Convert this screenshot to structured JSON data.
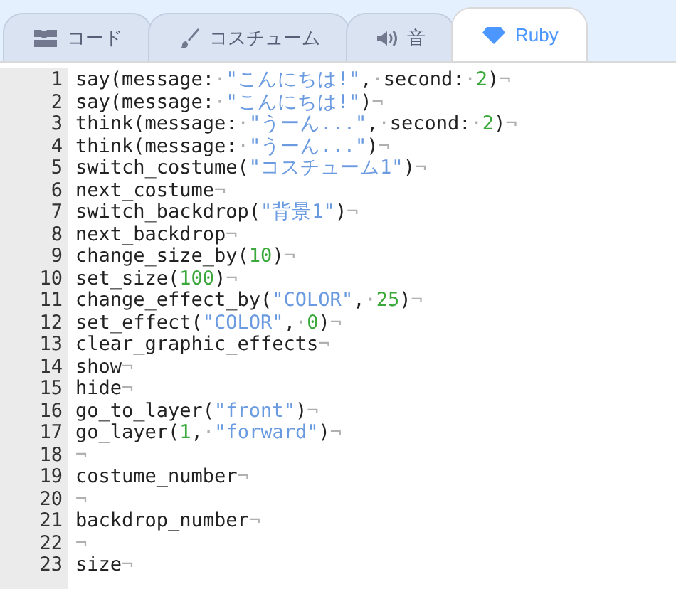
{
  "tabs": [
    {
      "label": "コード",
      "kind": "blocks",
      "selected": false
    },
    {
      "label": "コスチューム",
      "kind": "brush",
      "selected": false
    },
    {
      "label": "音",
      "kind": "speaker",
      "selected": false
    },
    {
      "label": "Ruby",
      "kind": "gem",
      "selected": true
    }
  ],
  "editor": {
    "lines": [
      {
        "number": "1",
        "tokens": [
          {
            "kind": "plain",
            "text": "say(message:"
          },
          {
            "kind": "mark",
            "text": "·"
          },
          {
            "kind": "string",
            "text": "\"こんにちは!\""
          },
          {
            "kind": "plain",
            "text": ","
          },
          {
            "kind": "mark",
            "text": "·"
          },
          {
            "kind": "plain",
            "text": "second:"
          },
          {
            "kind": "mark",
            "text": "·"
          },
          {
            "kind": "number",
            "text": "2"
          },
          {
            "kind": "plain",
            "text": ")"
          },
          {
            "kind": "mark",
            "text": "¬"
          }
        ]
      },
      {
        "number": "2",
        "tokens": [
          {
            "kind": "plain",
            "text": "say(message:"
          },
          {
            "kind": "mark",
            "text": "·"
          },
          {
            "kind": "string",
            "text": "\"こんにちは!\""
          },
          {
            "kind": "plain",
            "text": ")"
          },
          {
            "kind": "mark",
            "text": "¬"
          }
        ]
      },
      {
        "number": "3",
        "tokens": [
          {
            "kind": "plain",
            "text": "think(message:"
          },
          {
            "kind": "mark",
            "text": "·"
          },
          {
            "kind": "string",
            "text": "\"うーん...\""
          },
          {
            "kind": "plain",
            "text": ","
          },
          {
            "kind": "mark",
            "text": "·"
          },
          {
            "kind": "plain",
            "text": "second:"
          },
          {
            "kind": "mark",
            "text": "·"
          },
          {
            "kind": "number",
            "text": "2"
          },
          {
            "kind": "plain",
            "text": ")"
          },
          {
            "kind": "mark",
            "text": "¬"
          }
        ]
      },
      {
        "number": "4",
        "tokens": [
          {
            "kind": "plain",
            "text": "think(message:"
          },
          {
            "kind": "mark",
            "text": "·"
          },
          {
            "kind": "string",
            "text": "\"うーん...\""
          },
          {
            "kind": "plain",
            "text": ")"
          },
          {
            "kind": "mark",
            "text": "¬"
          }
        ]
      },
      {
        "number": "5",
        "tokens": [
          {
            "kind": "plain",
            "text": "switch_costume("
          },
          {
            "kind": "string",
            "text": "\"コスチューム1\""
          },
          {
            "kind": "plain",
            "text": ")"
          },
          {
            "kind": "mark",
            "text": "¬"
          }
        ]
      },
      {
        "number": "6",
        "tokens": [
          {
            "kind": "plain",
            "text": "next_costume"
          },
          {
            "kind": "mark",
            "text": "¬"
          }
        ]
      },
      {
        "number": "7",
        "tokens": [
          {
            "kind": "plain",
            "text": "switch_backdrop("
          },
          {
            "kind": "string",
            "text": "\"背景1\""
          },
          {
            "kind": "plain",
            "text": ")"
          },
          {
            "kind": "mark",
            "text": "¬"
          }
        ]
      },
      {
        "number": "8",
        "tokens": [
          {
            "kind": "plain",
            "text": "next_backdrop"
          },
          {
            "kind": "mark",
            "text": "¬"
          }
        ]
      },
      {
        "number": "9",
        "tokens": [
          {
            "kind": "plain",
            "text": "change_size_by("
          },
          {
            "kind": "number",
            "text": "10"
          },
          {
            "kind": "plain",
            "text": ")"
          },
          {
            "kind": "mark",
            "text": "¬"
          }
        ]
      },
      {
        "number": "10",
        "tokens": [
          {
            "kind": "plain",
            "text": "set_size("
          },
          {
            "kind": "number",
            "text": "100"
          },
          {
            "kind": "plain",
            "text": ")"
          },
          {
            "kind": "mark",
            "text": "¬"
          }
        ]
      },
      {
        "number": "11",
        "tokens": [
          {
            "kind": "plain",
            "text": "change_effect_by("
          },
          {
            "kind": "string",
            "text": "\"COLOR\""
          },
          {
            "kind": "plain",
            "text": ","
          },
          {
            "kind": "mark",
            "text": "·"
          },
          {
            "kind": "number",
            "text": "25"
          },
          {
            "kind": "plain",
            "text": ")"
          },
          {
            "kind": "mark",
            "text": "¬"
          }
        ]
      },
      {
        "number": "12",
        "tokens": [
          {
            "kind": "plain",
            "text": "set_effect("
          },
          {
            "kind": "string",
            "text": "\"COLOR\""
          },
          {
            "kind": "plain",
            "text": ","
          },
          {
            "kind": "mark",
            "text": "·"
          },
          {
            "kind": "number",
            "text": "0"
          },
          {
            "kind": "plain",
            "text": ")"
          },
          {
            "kind": "mark",
            "text": "¬"
          }
        ]
      },
      {
        "number": "13",
        "tokens": [
          {
            "kind": "plain",
            "text": "clear_graphic_effects"
          },
          {
            "kind": "mark",
            "text": "¬"
          }
        ]
      },
      {
        "number": "14",
        "tokens": [
          {
            "kind": "plain",
            "text": "show"
          },
          {
            "kind": "mark",
            "text": "¬"
          }
        ]
      },
      {
        "number": "15",
        "tokens": [
          {
            "kind": "plain",
            "text": "hide"
          },
          {
            "kind": "mark",
            "text": "¬"
          }
        ]
      },
      {
        "number": "16",
        "tokens": [
          {
            "kind": "plain",
            "text": "go_to_layer("
          },
          {
            "kind": "string",
            "text": "\"front\""
          },
          {
            "kind": "plain",
            "text": ")"
          },
          {
            "kind": "mark",
            "text": "¬"
          }
        ]
      },
      {
        "number": "17",
        "tokens": [
          {
            "kind": "plain",
            "text": "go_layer("
          },
          {
            "kind": "number",
            "text": "1"
          },
          {
            "kind": "plain",
            "text": ","
          },
          {
            "kind": "mark",
            "text": "·"
          },
          {
            "kind": "string",
            "text": "\"forward\""
          },
          {
            "kind": "plain",
            "text": ")"
          },
          {
            "kind": "mark",
            "text": "¬"
          }
        ]
      },
      {
        "number": "18",
        "tokens": [
          {
            "kind": "mark",
            "text": "¬"
          }
        ]
      },
      {
        "number": "19",
        "tokens": [
          {
            "kind": "plain",
            "text": "costume_number"
          },
          {
            "kind": "mark",
            "text": "¬"
          }
        ]
      },
      {
        "number": "20",
        "tokens": [
          {
            "kind": "mark",
            "text": "¬"
          }
        ]
      },
      {
        "number": "21",
        "tokens": [
          {
            "kind": "plain",
            "text": "backdrop_number"
          },
          {
            "kind": "mark",
            "text": "¬"
          }
        ]
      },
      {
        "number": "22",
        "tokens": [
          {
            "kind": "mark",
            "text": "¬"
          }
        ]
      },
      {
        "number": "23",
        "tokens": [
          {
            "kind": "plain",
            "text": "size"
          },
          {
            "kind": "mark",
            "text": "¬"
          }
        ]
      }
    ]
  }
}
